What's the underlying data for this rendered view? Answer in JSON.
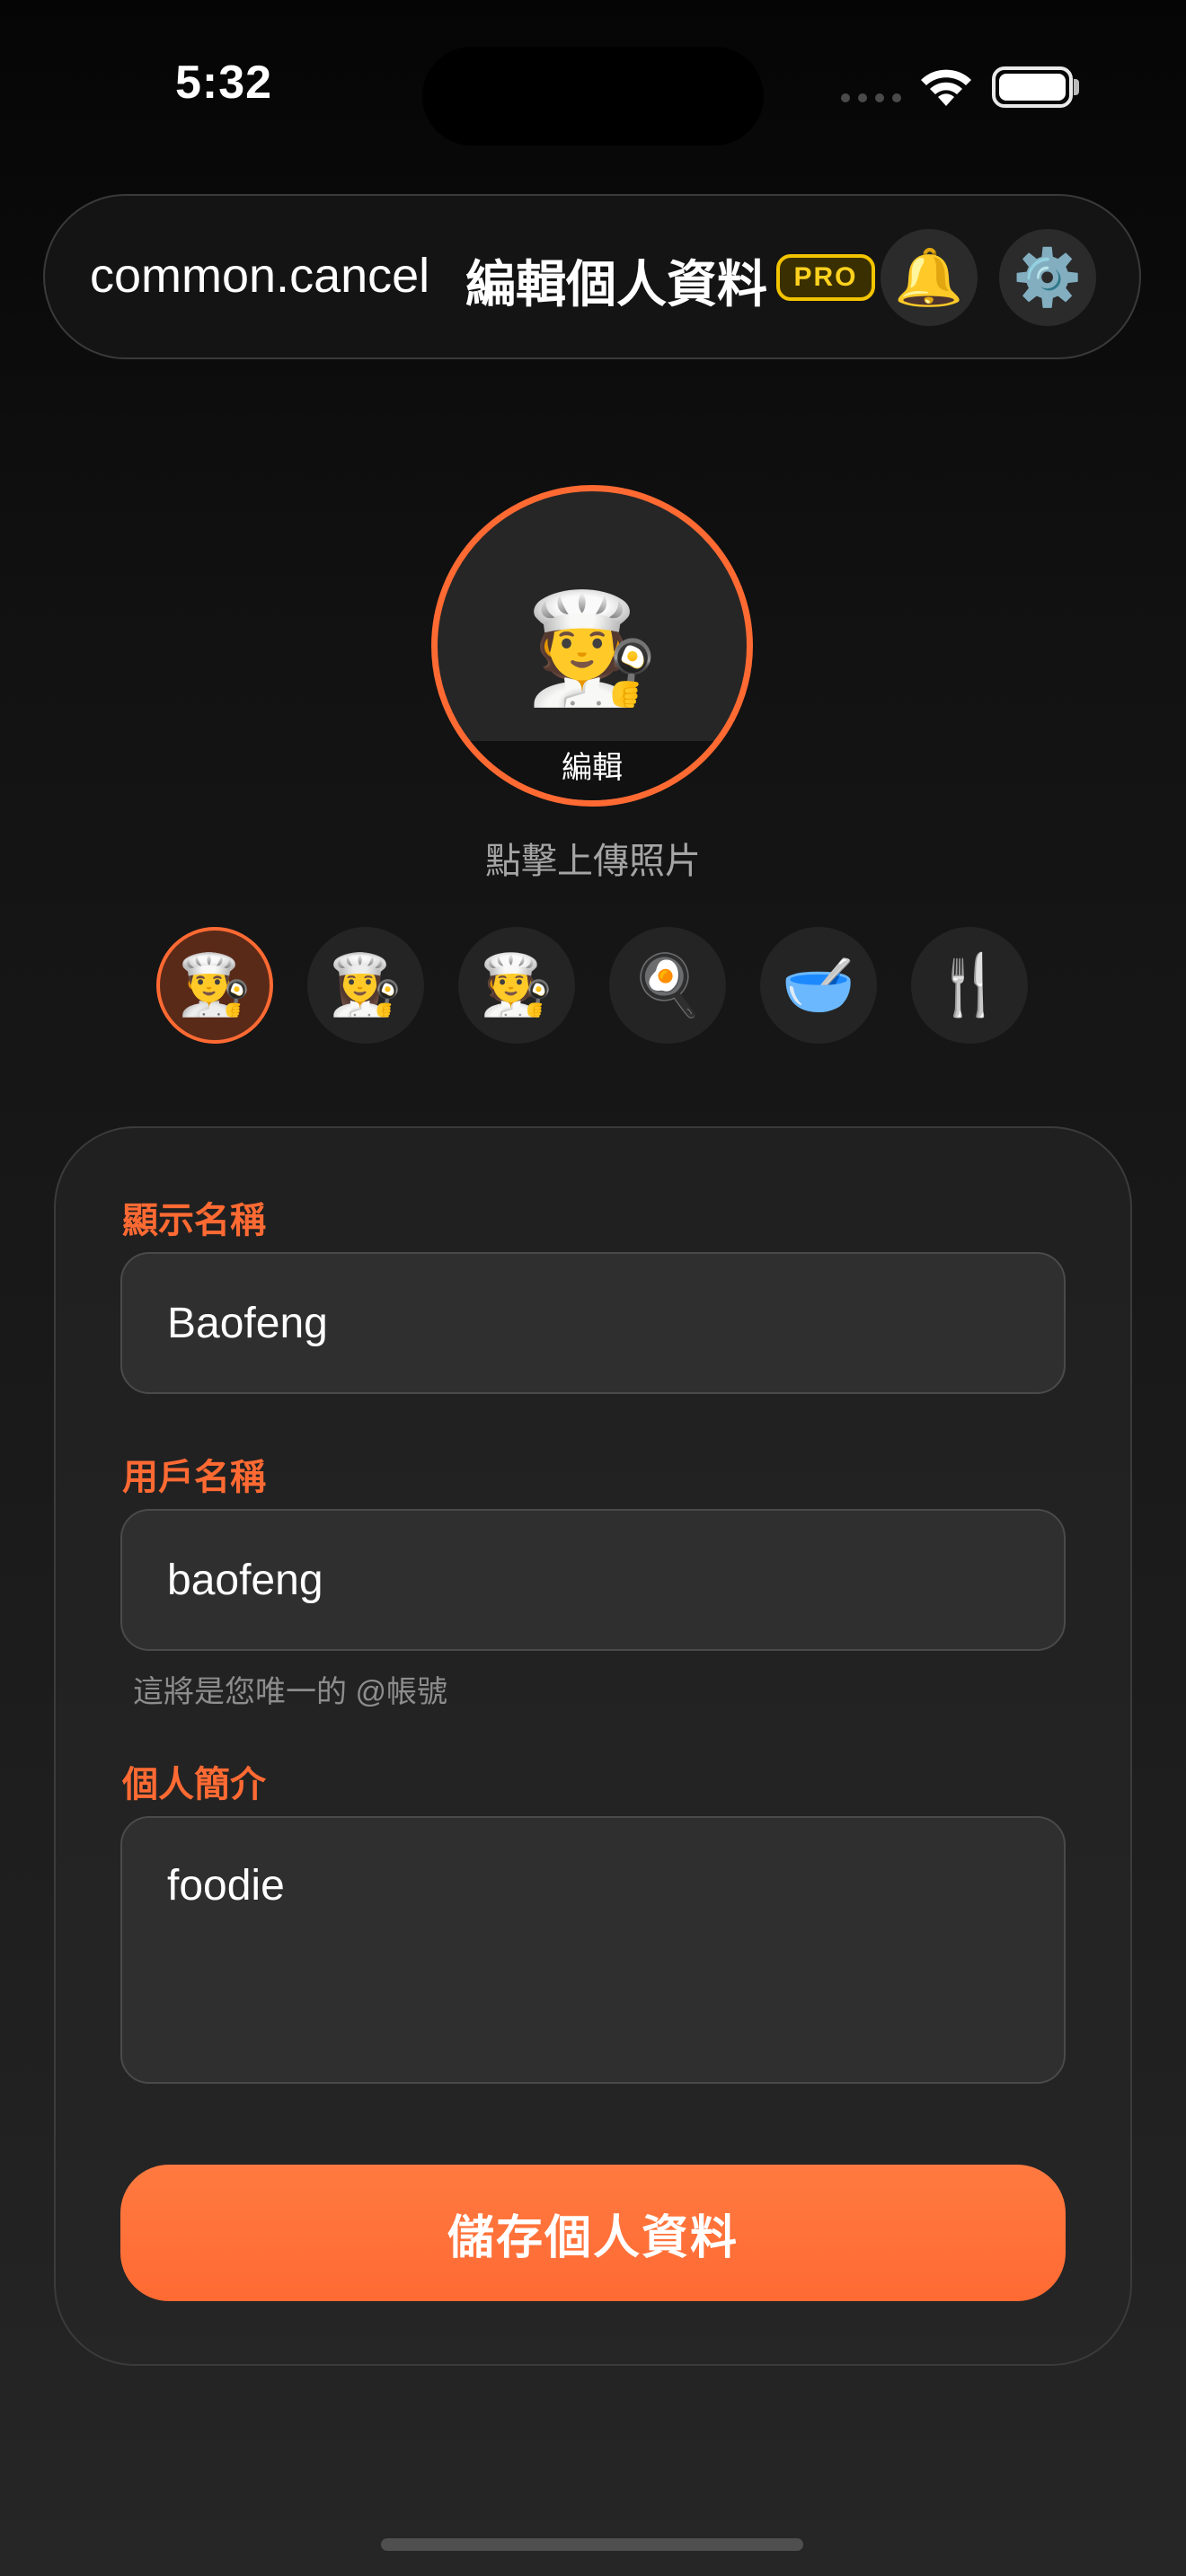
{
  "status_bar": {
    "time": "5:32",
    "icons": [
      "cellular-signal-icon",
      "wifi-icon",
      "battery-icon"
    ]
  },
  "header": {
    "cancel_label": "common.cancel",
    "title": "編輯個人資料",
    "pro_badge": "PRO",
    "bell_icon": "🔔",
    "gear_icon": "⚙️"
  },
  "avatar": {
    "emoji": "🧑‍🍳",
    "edit_label": "編輯",
    "upload_hint": "點擊上傳照片",
    "presets": [
      {
        "emoji": "👨‍🍳",
        "selected": true
      },
      {
        "emoji": "👩‍🍳",
        "selected": false
      },
      {
        "emoji": "🧑‍🍳",
        "selected": false
      },
      {
        "emoji": "🍳",
        "selected": false
      },
      {
        "emoji": "🥣",
        "selected": false
      },
      {
        "emoji": "🍴",
        "selected": false
      }
    ]
  },
  "form": {
    "display_name": {
      "label": "顯示名稱",
      "value": "Baofeng"
    },
    "username": {
      "label": "用戶名稱",
      "value": "baofeng",
      "helper": "這將是您唯一的 @帳號"
    },
    "bio": {
      "label": "個人簡介",
      "value": "foodie"
    },
    "save_label": "儲存個人資料"
  },
  "colors": {
    "accent": "#ff6a33",
    "pro_gold": "#f2c400",
    "background": "#121212"
  }
}
